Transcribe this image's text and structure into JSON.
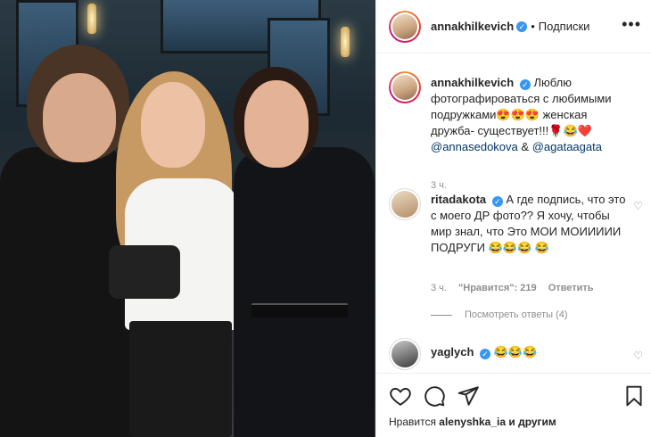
{
  "post": {
    "author": "annakhilkevich",
    "separator": "•",
    "follow_status": "Подписки",
    "more_icon": "more-horizontal-icon"
  },
  "caption": {
    "author": "annakhilkevich",
    "text": "Люблю фотографироваться с любимыми подружками",
    "emoji1": "😍😍😍",
    "text2": "женская дружба- существует!!!",
    "emoji2": "🌹😂❤️",
    "mention1": "@annasedokova",
    "amp": "&",
    "mention2": "@agataagata",
    "time": "3 ч."
  },
  "comment1": {
    "author": "ritadakota",
    "text": "А где подпись, что это с моего ДР фото?? Я хочу, чтобы мир знал, что Это МОИ МОИИИИИ ПОДРУГИ",
    "emoji": "😂😂😂 😂",
    "time": "3 ч.",
    "likes": "\"Нравится\": 219",
    "reply": "Ответить",
    "view_replies": "Посмотреть ответы (4)"
  },
  "comment2": {
    "author": "yaglych",
    "emoji": "😂😂😂"
  },
  "likes": {
    "prefix": "Нравится",
    "user": "alenyshka_ia",
    "suffix": "и другим"
  },
  "colors": {
    "text": "#262626",
    "muted": "#8e8e8e",
    "link": "#00376b",
    "verified": "#3897f0",
    "border": "#efefef"
  }
}
